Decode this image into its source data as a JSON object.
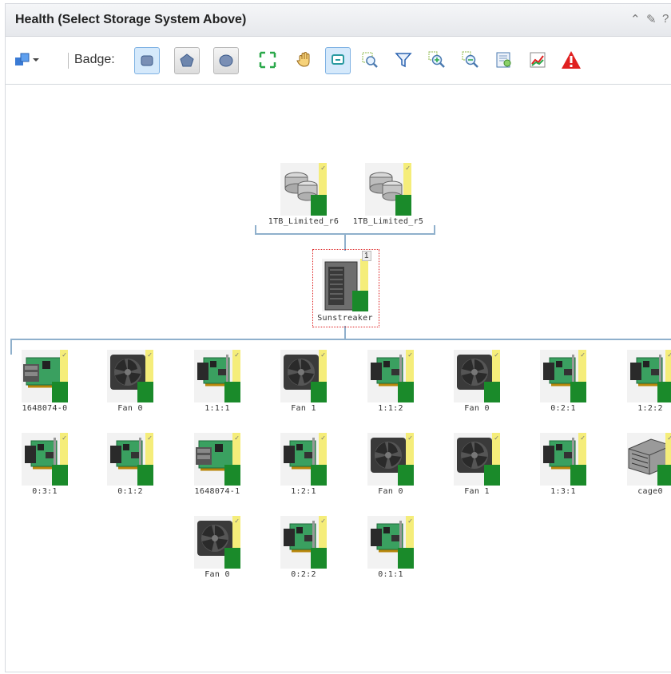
{
  "header": {
    "title": "Health (Select Storage System Above)"
  },
  "toolbar": {
    "badge_label": "Badge:",
    "tools": [
      "layout-menu-icon",
      "badge-health-icon",
      "badge-pentagon-icon",
      "badge-shape-icon",
      "fit-icon",
      "pan-icon",
      "select-icon",
      "zoom-area-icon",
      "filter-icon",
      "zoom-in-icon",
      "zoom-out-icon",
      "properties-icon",
      "chart-icon",
      "alert-icon"
    ]
  },
  "topology": {
    "volumes": [
      {
        "label": "1TB_Limited_r6",
        "icon": "disk-stack-icon"
      },
      {
        "label": "1TB_Limited_r5",
        "icon": "disk-stack-icon"
      }
    ],
    "system": {
      "label": "Sunstreaker",
      "icon": "server-tower-icon",
      "count": "1"
    },
    "rows": [
      [
        {
          "label": "1648074-0",
          "icon": "drive-cage-icon"
        },
        {
          "label": "Fan 0",
          "icon": "fan-icon"
        },
        {
          "label": "1:1:1",
          "icon": "port-card-icon"
        },
        {
          "label": "Fan 1",
          "icon": "fan-icon"
        },
        {
          "label": "1:1:2",
          "icon": "port-card-icon"
        },
        {
          "label": "Fan 0",
          "icon": "fan-icon"
        },
        {
          "label": "0:2:1",
          "icon": "port-card-icon"
        },
        {
          "label": "1:2:2",
          "icon": "port-card-icon"
        }
      ],
      [
        {
          "label": "0:3:1",
          "icon": "port-card-icon"
        },
        {
          "label": "0:1:2",
          "icon": "port-card-icon"
        },
        {
          "label": "1648074-1",
          "icon": "drive-cage-icon"
        },
        {
          "label": "1:2:1",
          "icon": "port-card-icon"
        },
        {
          "label": "Fan 0",
          "icon": "fan-icon"
        },
        {
          "label": "Fan 1",
          "icon": "fan-icon"
        },
        {
          "label": "1:3:1",
          "icon": "port-card-icon"
        },
        {
          "label": "cage0",
          "icon": "enclosure-icon"
        }
      ],
      [
        {
          "label": "Fan 0",
          "icon": "fan-icon"
        },
        {
          "label": "0:2:2",
          "icon": "port-card-icon"
        },
        {
          "label": "0:1:1",
          "icon": "port-card-icon"
        }
      ]
    ]
  },
  "colors": {
    "status_ok": "#1a8a2a",
    "status_badge": "#f5ed7a",
    "connector": "#8fb0cc",
    "alert": "#e02020"
  }
}
